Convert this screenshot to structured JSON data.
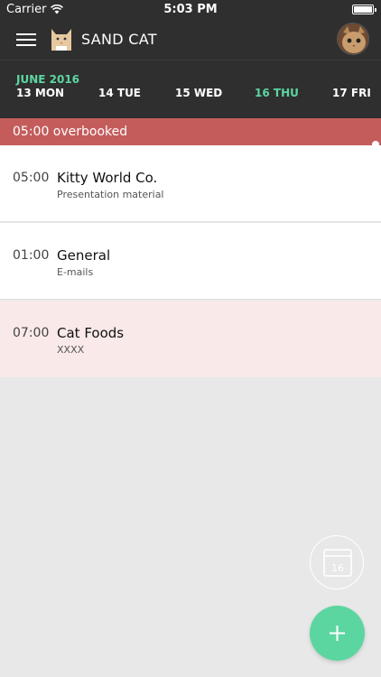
{
  "status_bar": {
    "carrier": "Carrier",
    "time": "5:03 PM"
  },
  "header": {
    "title": "SAND CAT",
    "menu_icon": "hamburger-icon",
    "logo_icon": "cat-logo-icon",
    "avatar": "user-avatar"
  },
  "date_strip": {
    "month": "JUNE 2016",
    "dates": [
      {
        "label": "13 MON",
        "selected": false
      },
      {
        "label": "14 TUE",
        "selected": false
      },
      {
        "label": "15 WED",
        "selected": false
      },
      {
        "label": "16 THU",
        "selected": true
      },
      {
        "label": "17 FRI",
        "selected": false
      }
    ]
  },
  "banner": {
    "text": "05:00 overbooked",
    "color": "#c45c5c"
  },
  "tasks": [
    {
      "duration": "05:00",
      "title": "Kitty World Co.",
      "subtitle": "Presentation material",
      "highlight": false
    },
    {
      "duration": "01:00",
      "title": "General",
      "subtitle": "E-mails",
      "highlight": false
    },
    {
      "duration": "07:00",
      "title": "Cat Foods",
      "subtitle": "XXXX",
      "highlight": true
    }
  ],
  "fabs": {
    "calendar_day": "16",
    "calendar_icon": "calendar-icon",
    "add_icon": "plus-icon"
  },
  "colors": {
    "accent": "#5cd6a0",
    "header_bg": "#2f2f2f",
    "overbooked": "#c45c5c",
    "highlight_row": "#f9e9e9"
  }
}
